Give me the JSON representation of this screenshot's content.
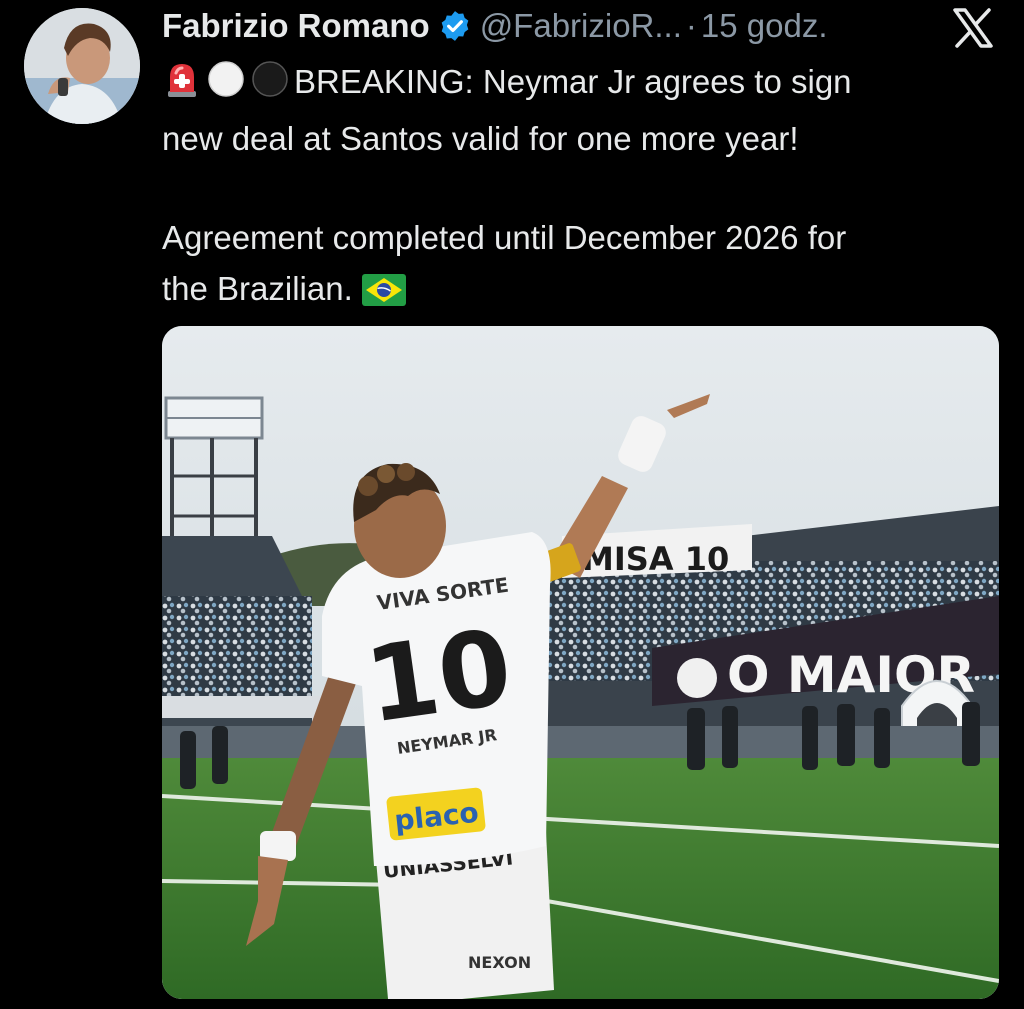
{
  "tweet": {
    "author_name": "Fabrizio Romano",
    "handle": "@FabrizioR...",
    "separator": "·",
    "time": "15 godz.",
    "text_line_1": "BREAKING: Neymar Jr agrees to sign",
    "text_line_2": "new deal at Santos valid for one more year!",
    "text_line_3": "Agreement completed until December 2026 for",
    "text_line_4": "the Brazilian.",
    "leading_emojis": [
      "siren-emoji",
      "white-circle-emoji",
      "black-circle-emoji"
    ],
    "trailing_emoji": "brazil-flag-emoji"
  },
  "media": {
    "banner_top_text": "MISA 10",
    "banner_main_text": "O MAIOR",
    "jersey_number": "10",
    "jersey_top_text": "VIVA SORTE",
    "jersey_name": "NEYMAR JR",
    "sponsor_text": "placo",
    "shorts_text": "UNIASSELVI",
    "brand_text": "NEXON"
  },
  "colors": {
    "background": "#000000",
    "text_primary": "#e7e9ea",
    "text_secondary": "#8b98a5",
    "verified_blue": "#1d9bf0"
  }
}
